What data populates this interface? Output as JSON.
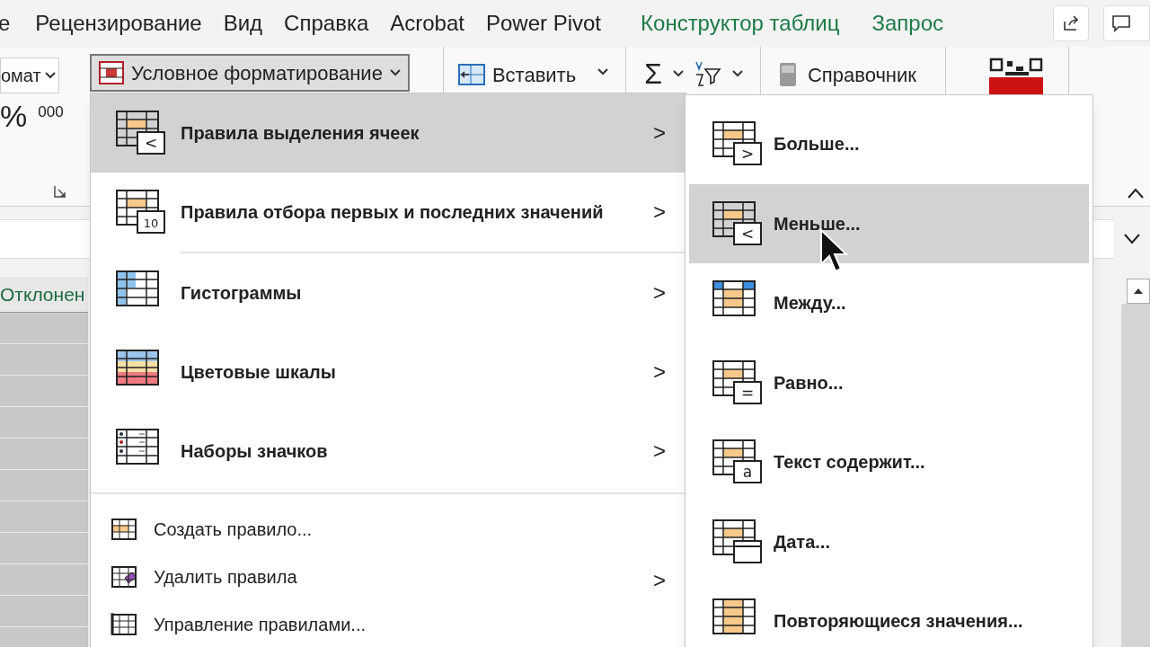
{
  "ribbon_tabs": [
    {
      "label": "е",
      "kind": "plain"
    },
    {
      "label": "Рецензирование",
      "kind": "plain"
    },
    {
      "label": "Вид",
      "kind": "plain"
    },
    {
      "label": "Справка",
      "kind": "plain"
    },
    {
      "label": "Acrobat",
      "kind": "plain"
    },
    {
      "label": "Power Pivot",
      "kind": "plain"
    },
    {
      "label": "Конструктор таблиц",
      "kind": "context"
    },
    {
      "label": "Запрос",
      "kind": "context"
    }
  ],
  "ribbon": {
    "format_dropdown": "омат",
    "percent": "%",
    "thousands": "000",
    "conditional_formatting": {
      "label": "Условное форматирование",
      "pressed": true
    },
    "insert": "Вставить",
    "sum": "Σ",
    "reference": "Справочник"
  },
  "sheet": {
    "column_header": "Отклонен"
  },
  "menu": {
    "items": [
      {
        "label": "Правила выделения ячеек",
        "kind": "highlight",
        "badge": "<",
        "submenu": true,
        "selected": true
      },
      {
        "label": "Правила отбора первых и последних значений",
        "kind": "highlight",
        "badge": "10",
        "submenu": true,
        "selected": false
      },
      {
        "label": "Гистограммы",
        "kind": "databars",
        "submenu": true,
        "selected": false
      },
      {
        "label": "Цветовые шкалы",
        "kind": "scales",
        "submenu": true,
        "selected": false
      },
      {
        "label": "Наборы значков",
        "kind": "iconsets",
        "submenu": true,
        "selected": false
      }
    ],
    "actions": [
      {
        "label": "Создать правило...",
        "kind": "new",
        "submenu": false
      },
      {
        "label": "Удалить правила",
        "kind": "clear",
        "submenu": true
      },
      {
        "label": "Управление правилами...",
        "kind": "manage",
        "submenu": false
      }
    ],
    "arrow": ">"
  },
  "submenu": {
    "items": [
      {
        "label": "Больше...",
        "kind": "badge",
        "badge": ">",
        "selected": false
      },
      {
        "label": "Меньше...",
        "kind": "badge",
        "badge": "<",
        "selected": true
      },
      {
        "label": "Между...",
        "kind": "between",
        "selected": false
      },
      {
        "label": "Равно...",
        "kind": "badge",
        "badge": "=",
        "selected": false
      },
      {
        "label": "Текст содержит...",
        "kind": "badge",
        "badge": "a",
        "selected": false
      },
      {
        "label": "Дата...",
        "kind": "calendar",
        "selected": false
      },
      {
        "label": "Повторяющиеся значения...",
        "kind": "duplicates",
        "selected": false
      }
    ]
  }
}
